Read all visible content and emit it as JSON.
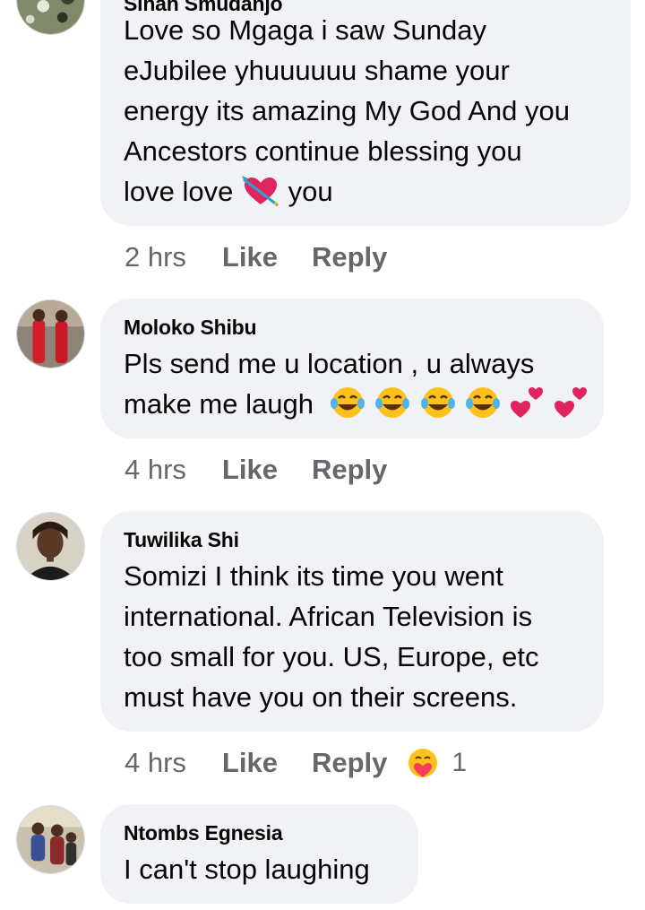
{
  "comments": [
    {
      "author": "Sinah Smudanjo",
      "lines": [
        "Love so Mgaga i saw Sunday",
        "eJubilee  yhuuuuuu shame your",
        "energy its amazing My God And you",
        "Ancestors continue blessing you",
        "love love",
        "you"
      ],
      "time": "2 hrs",
      "emojis": [
        "heart-with-arrow"
      ]
    },
    {
      "author": "Moloko Shibu",
      "lines": [
        "Pls  send me u location , u always",
        "make me laugh"
      ],
      "time": "4 hrs",
      "emojis": [
        "tears-of-joy",
        "tears-of-joy",
        "tears-of-joy",
        "tears-of-joy",
        "two-hearts",
        "two-hearts"
      ]
    },
    {
      "author": "Tuwilika Shi",
      "lines": [
        "Somizi I think its time you went",
        "international. African Television is",
        "too small for you. US, Europe, etc",
        "must have you on their screens."
      ],
      "time": "4 hrs",
      "reaction": {
        "icon": "care-reaction",
        "count": "1"
      }
    },
    {
      "author": "Ntombs Egnesia",
      "lines": [
        "I can't stop laughing"
      ],
      "time": ""
    }
  ],
  "actions": {
    "like": "Like",
    "reply": "Reply"
  }
}
